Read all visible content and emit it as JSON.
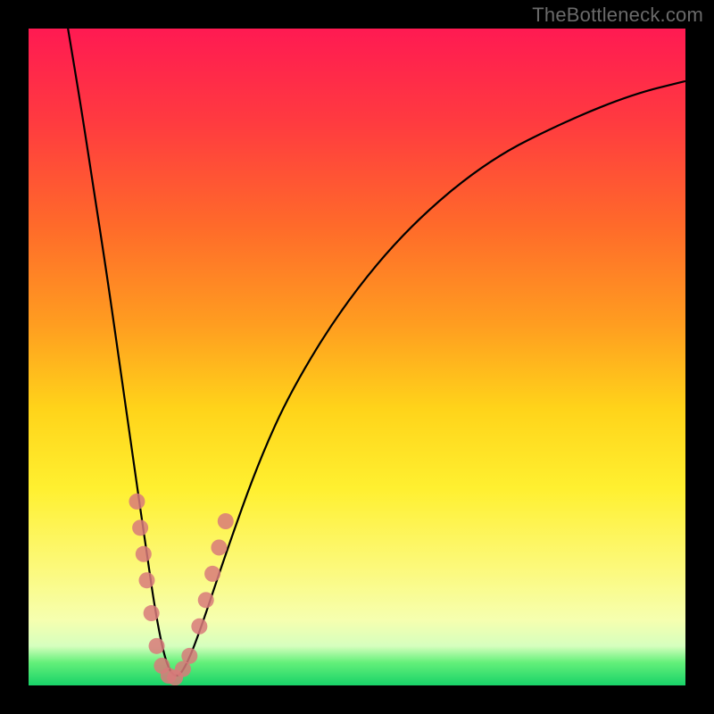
{
  "watermark": "TheBottleneck.com",
  "chart_data": {
    "type": "line",
    "title": "",
    "xlabel": "",
    "ylabel": "",
    "xlim": [
      0,
      100
    ],
    "ylim": [
      0,
      100
    ],
    "grid": false,
    "legend": false,
    "series": [
      {
        "name": "bottleneck-curve",
        "color": "#000000",
        "x": [
          6,
          8,
          10,
          12,
          14,
          16,
          18,
          19.5,
          21,
          22.5,
          24,
          26,
          30,
          35,
          40,
          48,
          58,
          70,
          82,
          92,
          100
        ],
        "values": [
          100,
          88,
          75,
          62,
          48,
          34,
          20,
          10,
          3,
          1,
          3,
          8,
          20,
          34,
          45,
          58,
          70,
          80,
          86,
          90,
          92
        ]
      }
    ],
    "markers": [
      {
        "name": "highlight-dots",
        "color": "#d87a7a",
        "points": [
          {
            "x": 16.5,
            "y": 28
          },
          {
            "x": 17.0,
            "y": 24
          },
          {
            "x": 17.5,
            "y": 20
          },
          {
            "x": 18.0,
            "y": 16
          },
          {
            "x": 18.7,
            "y": 11
          },
          {
            "x": 19.5,
            "y": 6
          },
          {
            "x": 20.3,
            "y": 3
          },
          {
            "x": 21.3,
            "y": 1.5
          },
          {
            "x": 22.3,
            "y": 1.2
          },
          {
            "x": 23.5,
            "y": 2.5
          },
          {
            "x": 24.5,
            "y": 4.5
          },
          {
            "x": 26.0,
            "y": 9
          },
          {
            "x": 27.0,
            "y": 13
          },
          {
            "x": 28.0,
            "y": 17
          },
          {
            "x": 29.0,
            "y": 21
          },
          {
            "x": 30.0,
            "y": 25
          }
        ]
      }
    ],
    "gradient_stops": [
      {
        "pos": 0,
        "color": "#ff1a52"
      },
      {
        "pos": 50,
        "color": "#ffb020"
      },
      {
        "pos": 80,
        "color": "#fff24a"
      },
      {
        "pos": 97,
        "color": "#7df08a"
      },
      {
        "pos": 100,
        "color": "#18d268"
      }
    ]
  }
}
